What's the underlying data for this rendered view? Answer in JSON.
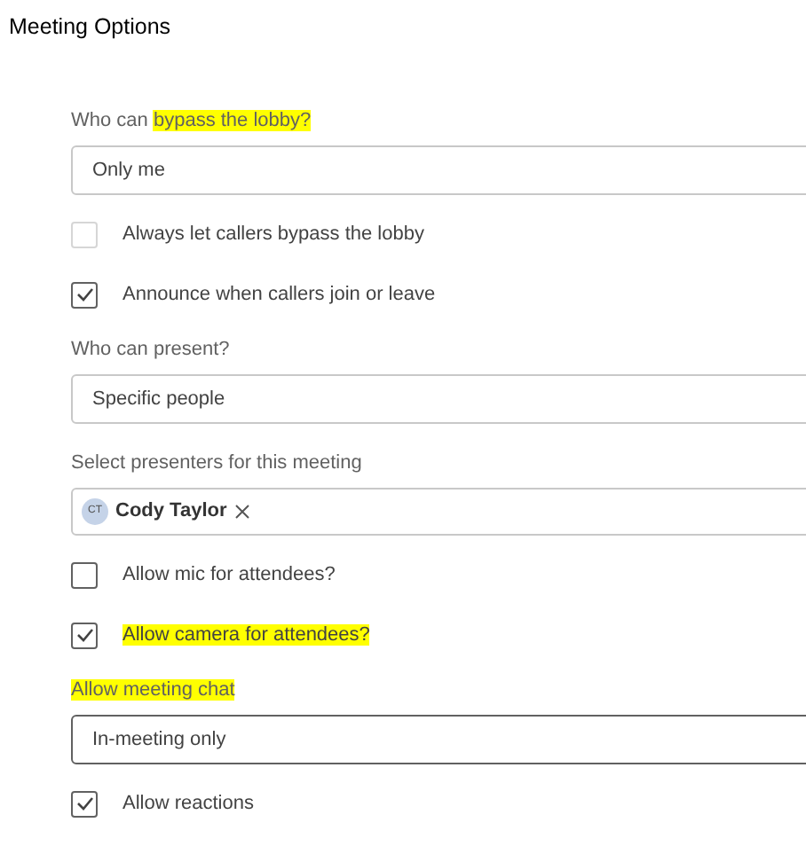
{
  "window": {
    "title": "Meeting Options"
  },
  "items": [
    {
      "kind": "label",
      "parts": [
        {
          "text": "Who can ",
          "highlighted": false
        },
        {
          "text": "bypass the lobby?",
          "highlighted": true
        }
      ]
    },
    {
      "kind": "select",
      "value": "Only me",
      "focused": false
    },
    {
      "kind": "checkbox",
      "parts": [
        {
          "text": "Always let callers bypass the lobby",
          "highlighted": false
        }
      ],
      "checked": false,
      "disabled": true
    },
    {
      "kind": "checkbox",
      "parts": [
        {
          "text": "Announce when callers join or leave",
          "highlighted": false
        }
      ],
      "checked": true,
      "disabled": false
    },
    {
      "kind": "label",
      "parts": [
        {
          "text": "Who can present?",
          "highlighted": false
        }
      ]
    },
    {
      "kind": "select",
      "value": "Specific people",
      "focused": false
    },
    {
      "kind": "label",
      "parts": [
        {
          "text": "Select presenters for this meeting",
          "highlighted": false
        }
      ]
    },
    {
      "kind": "people",
      "people": [
        {
          "initials": "CT",
          "name": "Cody Taylor"
        }
      ]
    },
    {
      "kind": "checkbox",
      "parts": [
        {
          "text": "Allow mic for attendees?",
          "highlighted": false
        }
      ],
      "checked": false,
      "disabled": false
    },
    {
      "kind": "checkbox",
      "parts": [
        {
          "text": "Allow camera for attendees?",
          "highlighted": true
        }
      ],
      "checked": true,
      "disabled": false
    },
    {
      "kind": "label",
      "parts": [
        {
          "text": "Allow meeting chat",
          "highlighted": true
        }
      ]
    },
    {
      "kind": "select",
      "value": "In-meeting only",
      "focused": true
    },
    {
      "kind": "checkbox",
      "parts": [
        {
          "text": "Allow reactions",
          "highlighted": false
        }
      ],
      "checked": true,
      "disabled": false
    }
  ]
}
